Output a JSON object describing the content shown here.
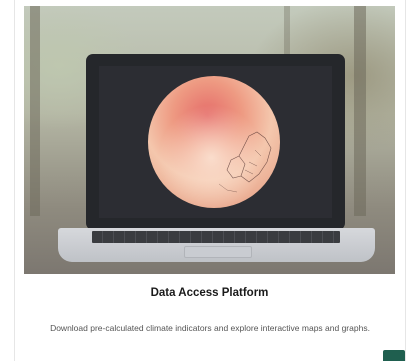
{
  "card": {
    "title": "Data Access Platform",
    "description": "Download pre-calculated climate indicators and explore interactive maps and graphs."
  },
  "colors": {
    "corner_accent": "#1f5f4f",
    "globe_warm": "#d9545a",
    "globe_light": "#f3c4ad"
  },
  "icons": {
    "hero": "laptop-globe-illustration"
  }
}
